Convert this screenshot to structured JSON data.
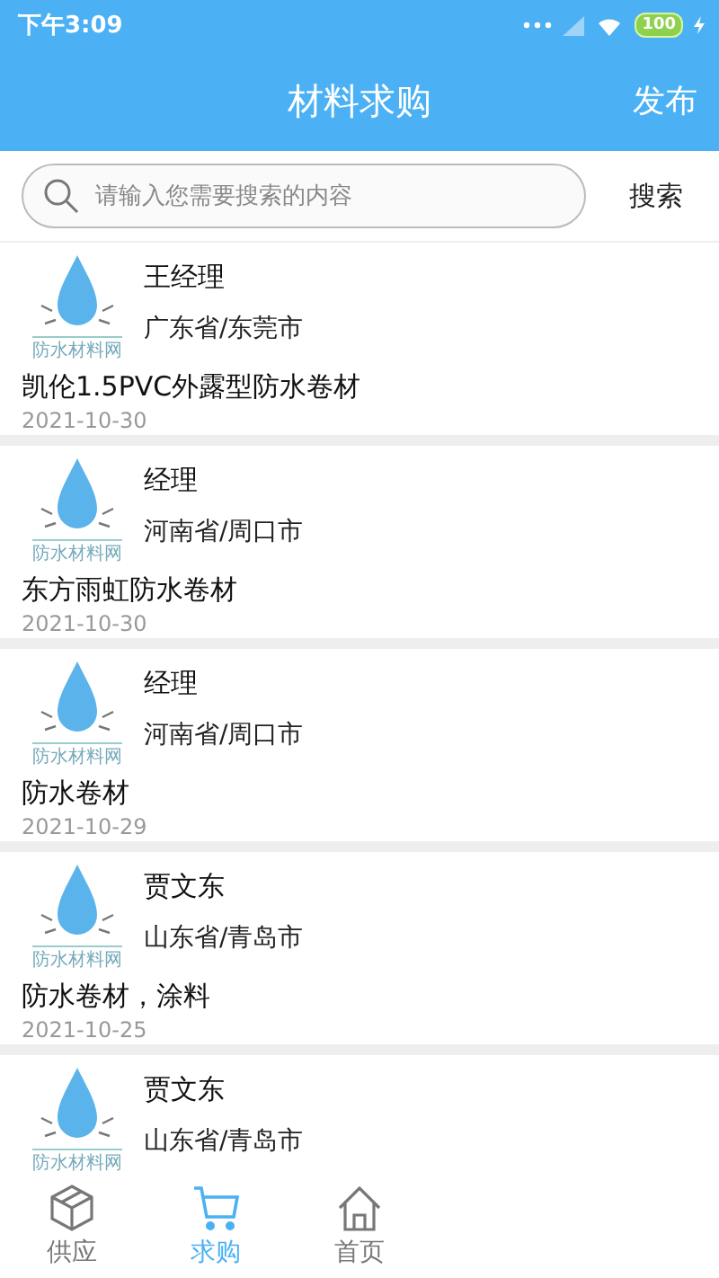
{
  "status_bar": {
    "time": "下午3:09",
    "battery": "100"
  },
  "header": {
    "title": "材料求购",
    "action": "发布"
  },
  "search": {
    "placeholder": "请输入您需要搜索的内容",
    "button": "搜索"
  },
  "posts": [
    {
      "logo_text": "防水材料网",
      "contact": "王经理",
      "location": "广东省/东莞市",
      "title": "凯伦1.5PVC外露型防水卷材",
      "date": "2021-10-30"
    },
    {
      "logo_text": "防水材料网",
      "contact": "经理",
      "location": "河南省/周口市",
      "title": "东方雨虹防水卷材",
      "date": "2021-10-30"
    },
    {
      "logo_text": "防水材料网",
      "contact": "经理",
      "location": "河南省/周口市",
      "title": "防水卷材",
      "date": "2021-10-29"
    },
    {
      "logo_text": "防水材料网",
      "contact": "贾文东",
      "location": "山东省/青岛市",
      "title": "防水卷材，涂料",
      "date": "2021-10-25"
    },
    {
      "logo_text": "防水材料网",
      "contact": "贾文东",
      "location": "山东省/青岛市"
    }
  ],
  "tab_bar": [
    {
      "kind": "box",
      "label": "供应",
      "selected": false
    },
    {
      "kind": "cart",
      "label": "求购",
      "selected": true
    },
    {
      "kind": "home",
      "label": "首页",
      "selected": false
    }
  ]
}
